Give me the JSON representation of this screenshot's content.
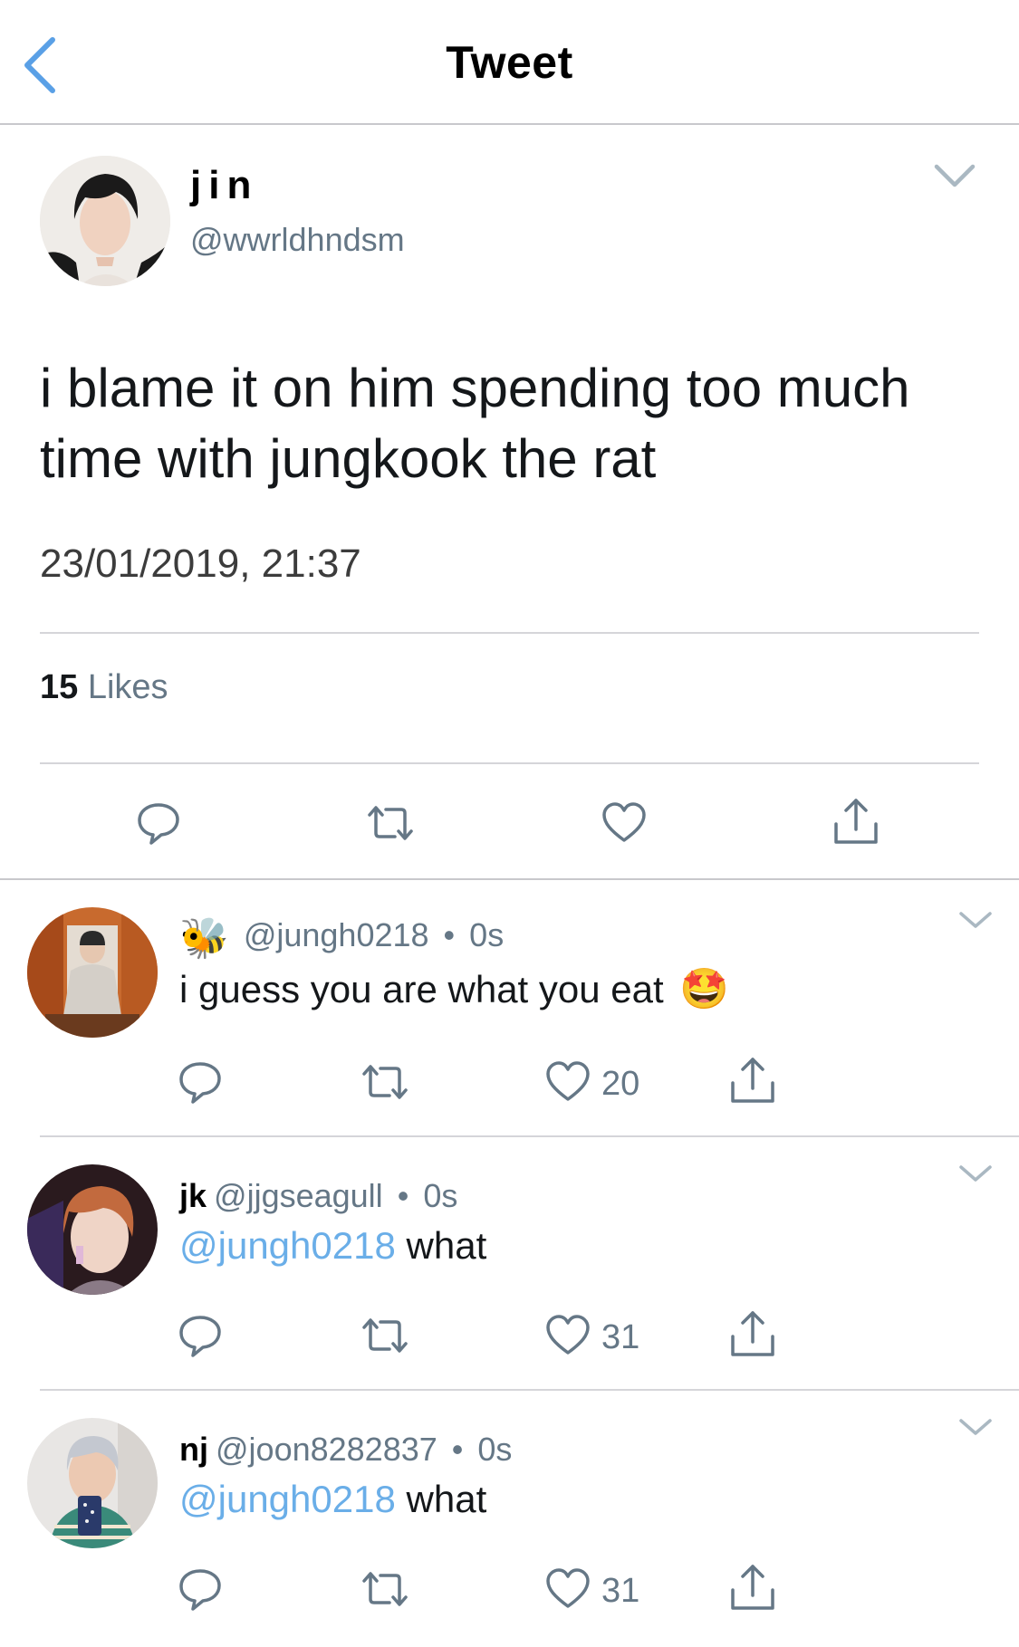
{
  "header": {
    "title": "Tweet",
    "back_icon": "chevron-left-icon"
  },
  "main_tweet": {
    "name": "jin",
    "handle": "@wwrldhndsm",
    "text": "i blame it on him spending too much time with jungkook the rat",
    "timestamp": "23/01/2019, 21:37",
    "likes_count": "15",
    "likes_label": "Likes",
    "actions": [
      "reply-icon",
      "retweet-icon",
      "like-icon",
      "share-icon"
    ]
  },
  "replies": [
    {
      "name_emoji": "🐝",
      "handle": "@jungh0218",
      "separator": "•",
      "time": "0s",
      "text": "i guess you are what you eat",
      "emoji": "🤩",
      "likes": "20"
    },
    {
      "name": "jk",
      "handle": "@jjgseagull",
      "separator": "•",
      "time": "0s",
      "mention": "@jungh0218",
      "text": "what",
      "likes": "31"
    },
    {
      "name": "nj",
      "handle": "@joon8282837",
      "separator": "•",
      "time": "0s",
      "mention": "@jungh0218",
      "text": "what",
      "likes": "31"
    }
  ],
  "colors": {
    "accent": "#6aaee8",
    "muted": "#657786",
    "text": "#14171a",
    "divider": "#d5d5d9"
  }
}
